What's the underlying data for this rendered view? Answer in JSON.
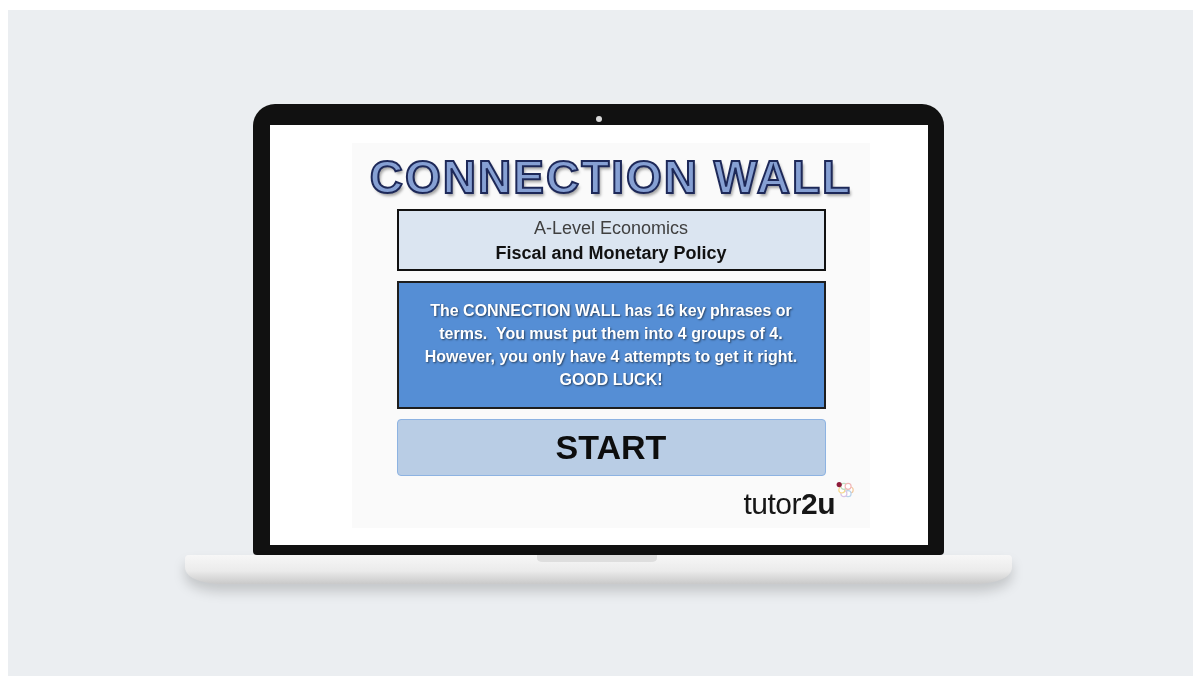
{
  "title": "CONNECTION WALL",
  "subject": {
    "level": "A-Level Economics",
    "topic": "Fiscal and Monetary Policy"
  },
  "instructions": "The CONNECTION WALL has 16 key phrases or\nterms.  You must put them into 4 groups of 4.\nHowever, you only have 4 attempts to get it right.\nGOOD LUCK!",
  "start_button": {
    "label": "START"
  },
  "logo": {
    "text": "tutor**2u**"
  }
}
